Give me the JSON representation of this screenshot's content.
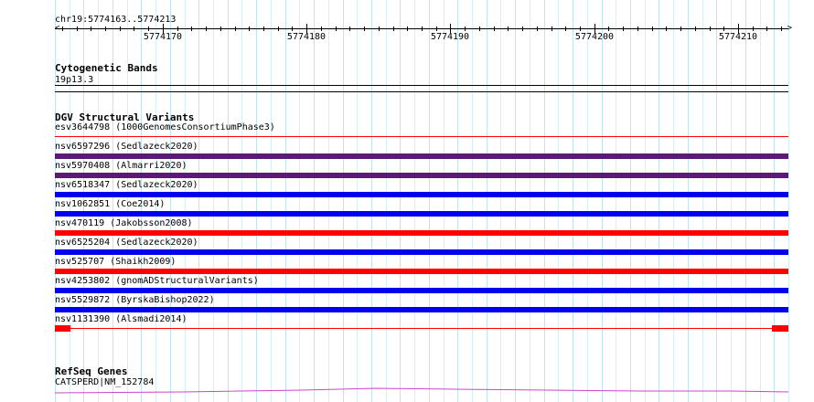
{
  "ruler": {
    "position": "chr19:5774163..5774213",
    "tick_labels": [
      "5774170",
      "5774180",
      "5774190",
      "5774200",
      "5774210"
    ],
    "range_start": 5774163,
    "range_end": 5774213,
    "label_positions": [
      5774170,
      5774180,
      5774190,
      5774200,
      5774210
    ]
  },
  "cytoband": {
    "title": "Cytogenetic Bands",
    "band": "19p13.3"
  },
  "dgv": {
    "title": "DGV Structural Variants",
    "items": [
      {
        "label": "esv3644798 (1000GenomesConsortiumPhase3)",
        "color": "#ff0000",
        "style": "thin"
      },
      {
        "label": "nsv6597296 (Sedlazeck2020)",
        "color": "#5c1a78",
        "style": "bar"
      },
      {
        "label": "nsv5970408 (Almarri2020)",
        "color": "#5c1a78",
        "style": "bar"
      },
      {
        "label": "nsv6518347 (Sedlazeck2020)",
        "color": "#0000ee",
        "style": "bar"
      },
      {
        "label": "nsv1062851 (Coe2014)",
        "color": "#0000ee",
        "style": "bar"
      },
      {
        "label": "nsv470119 (Jakobsson2008)",
        "color": "#ff0000",
        "style": "bar"
      },
      {
        "label": "nsv6525204 (Sedlazeck2020)",
        "color": "#0000ee",
        "style": "bar"
      },
      {
        "label": "nsv525707 (Shaikh2009)",
        "color": "#ff0000",
        "style": "bar"
      },
      {
        "label": "nsv4253802 (gnomADStructuralVariants)",
        "color": "#0000ee",
        "style": "bar"
      },
      {
        "label": "nsv5529872 (ByrskaBishop2022)",
        "color": "#0000ee",
        "style": "bar"
      },
      {
        "label": "nsv1131390 (Alsmadi2014)",
        "color": "#ff0000",
        "style": "gap"
      }
    ]
  },
  "refseq": {
    "title": "RefSeq Genes",
    "gene": "CATSPERD|NM_152784",
    "color": "#cc44cc"
  }
}
